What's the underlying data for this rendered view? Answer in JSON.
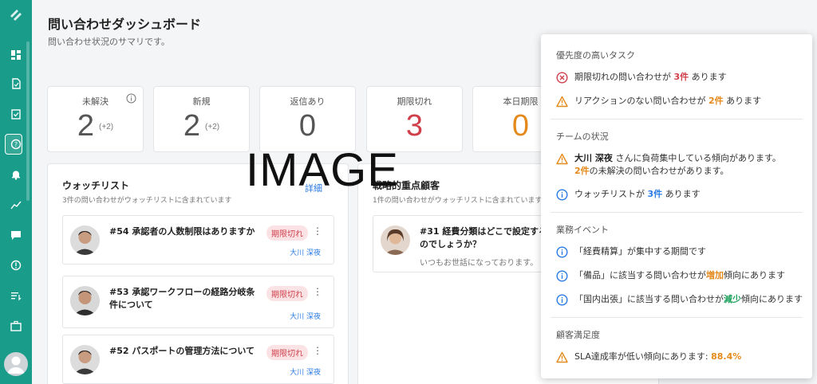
{
  "header": {
    "title": "問い合わせダッシュボード",
    "subtitle": "問い合わせ状況のサマリです。"
  },
  "stats": [
    {
      "label": "未解決",
      "value": "2",
      "delta": "(+2)"
    },
    {
      "label": "新規",
      "value": "2",
      "delta": "(+2)"
    },
    {
      "label": "返信あり",
      "value": "0"
    },
    {
      "label": "期限切れ",
      "value": "3",
      "color": "#d0404b"
    },
    {
      "label": "本日期限",
      "value": "0",
      "color": "#e48a1c"
    }
  ],
  "watchlist": {
    "title": "ウォッチリスト",
    "subtitle": "3件の問い合わせがウォッチリストに含まれています",
    "link": "詳細",
    "items": [
      {
        "title": "#54 承認者の人数制限はありますか",
        "badge": "期限切れ",
        "assignee": "大川 深夜"
      },
      {
        "title": "#53 承認ワークフローの経路分岐条件について",
        "badge": "期限切れ",
        "assignee": "大川 深夜"
      },
      {
        "title": "#52 パスポートの管理方法について",
        "badge": "期限切れ",
        "assignee": "大川 深夜"
      }
    ]
  },
  "strategic": {
    "title": "戦略的重点顧客",
    "subtitle": "1件の問い合わせがウォッチリストに含まれています",
    "items": [
      {
        "title": "#31 経費分類はどこで設定するのでしょうか？",
        "body": "いつもお世話になっております。"
      }
    ]
  },
  "popover": {
    "sections": [
      {
        "title": "優先度の高いタスク",
        "rows": [
          {
            "icon": "error",
            "pre": "期限切れの問い合わせが",
            "hl": "3件",
            "post": "あります"
          },
          {
            "icon": "warning",
            "pre": "リアクションのない問い合わせが",
            "hl": "2件",
            "post": "あります"
          }
        ]
      },
      {
        "title": "チームの状況",
        "rows": [
          {
            "icon": "warning",
            "name": "大川 深夜",
            "pre": "さんに負荷集中している傾向があります。",
            "hl": "2件",
            "post": "の未解決の問い合わせがあります。"
          },
          {
            "icon": "info",
            "pre": "ウォッチリストが",
            "hl": "3件",
            "post": "あります"
          }
        ]
      },
      {
        "title": "業務イベント",
        "rows": [
          {
            "icon": "info",
            "pre": "「経費精算」が集中する期間です"
          },
          {
            "icon": "info",
            "pre": "「備品」に該当する問い合わせが",
            "hl": "増加",
            "post": "傾向にあります"
          },
          {
            "icon": "info",
            "pre": "「国内出張」に該当する問い合わせが",
            "hl": "減少",
            "post": "傾向にあります"
          }
        ]
      },
      {
        "title": "顧客満足度",
        "rows": [
          {
            "icon": "warning",
            "pre": "SLA達成率が低い傾向にあります:",
            "hl": "88.4%"
          }
        ]
      }
    ]
  },
  "placeholder": "IMAGE",
  "colors": {
    "sidebar": "#1a9c8a",
    "red": "#d0404b",
    "orange": "#e48a1c",
    "blue": "#2a7be4",
    "green": "#1aa05a"
  }
}
